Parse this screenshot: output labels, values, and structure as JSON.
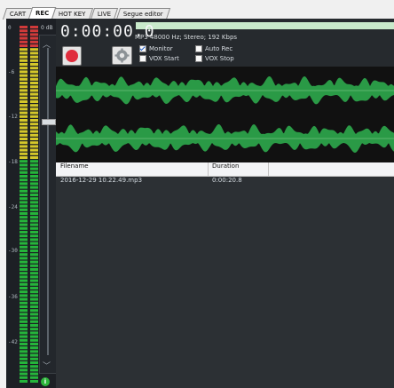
{
  "tabs": [
    {
      "label": "CART"
    },
    {
      "label": "REC"
    },
    {
      "label": "HOT KEY"
    },
    {
      "label": "LIVE"
    },
    {
      "label": "Segue editor"
    }
  ],
  "meter": {
    "labels": [
      "0",
      "-6",
      "-12",
      "-18",
      "-24",
      "-30",
      "-36",
      "-42"
    ],
    "scale_label": "0 dB"
  },
  "recorder": {
    "timer": "0:00:00.0",
    "format": "MP3  48000 Hz; Stereo; 192 Kbps",
    "checkboxes": {
      "monitor": {
        "label": "Monitor",
        "checked": true
      },
      "auto_rec": {
        "label": "Auto Rec",
        "checked": false
      },
      "vox_start": {
        "label": "VOX Start",
        "checked": false
      },
      "vox_stop": {
        "label": "VOX Stop",
        "checked": false
      }
    }
  },
  "table": {
    "headers": {
      "filename": "Filename",
      "duration": "Duration"
    },
    "rows": [
      {
        "filename": "2016-12-29 10.22.49.mp3",
        "duration": "0:00:20.8"
      }
    ]
  },
  "colors": {
    "waveform": "#2ca24a",
    "meter_green": "#25b53b",
    "meter_yellow": "#d4c72a",
    "meter_red": "#d13a3a"
  }
}
